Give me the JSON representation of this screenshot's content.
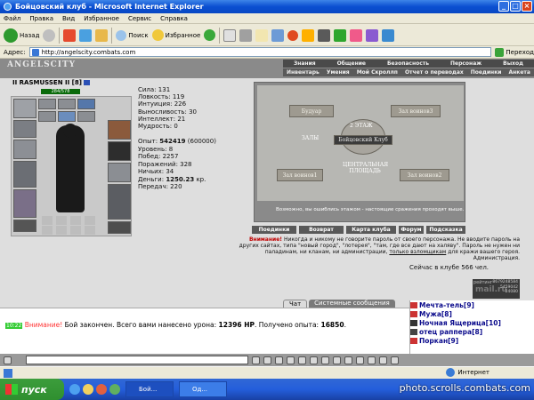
{
  "window": {
    "title": "Бойцовский клуб - Microsoft Internet Explorer"
  },
  "menubar": [
    "Файл",
    "Правка",
    "Вид",
    "Избранное",
    "Сервис",
    "Справка"
  ],
  "toolbar": {
    "back": "Назад",
    "search": "Поиск",
    "favorites": "Избранное"
  },
  "address": {
    "label": "Адрес:",
    "url": "http://angelscity.combats.com",
    "go": "Переход"
  },
  "site": {
    "logo": "ANGELSCITY",
    "nav_top": [
      "Знания",
      "Общение",
      "Безопасность",
      "Персонаж",
      "Выход"
    ],
    "nav_sub": [
      "Инвентарь",
      "Умения",
      "Мой Скроллп",
      "Отчет о переводах",
      "Поединки",
      "Анкета"
    ]
  },
  "character": {
    "name": "II RASMUSSEN II",
    "level_badge": "[8]",
    "hp": "284/578",
    "stats": [
      "Сила: 131",
      "Ловкость: 119",
      "Интуиция: 226",
      "Выносливость: 30",
      "Интеллект: 21",
      "Мудрость: 0"
    ],
    "exp_label": "Опыт:",
    "exp_value": "542419",
    "exp_next": "(600000)",
    "level": "Уровень: 8",
    "wins": "Побед: 2257",
    "losses": "Поражений: 328",
    "draws": "Ничьих: 34",
    "money_label": "Деньги:",
    "money_value": "1250.23",
    "money_unit": "кр.",
    "transfers": "Передач: 220"
  },
  "map": {
    "rooms": {
      "buduar": "Будуар",
      "floor2": "2 ЭТАЖ",
      "room_top_right": "Зал воинов3",
      "halls": "ЗАЛЫ",
      "center": "Бойцовский Клуб",
      "room_left": "Зал воинов1",
      "central_square": "ЦЕНТРАЛЬНАЯ ПЛОЩАДЬ",
      "room_right": "Зал воинов2"
    },
    "caption": "Возможно, вы ошиблись этажом - настоящие сражения проходят выше."
  },
  "buttons": [
    "Поединки",
    "Возврат",
    "Карта клуба",
    "Форум",
    "Подсказка"
  ],
  "notice": {
    "warn": "Внимание!",
    "text1": "Никогда и никому не говорите пароль от своего персонажа. Не вводите пароль на",
    "text2": "других сайтах, типа \"новый город\", \"лотерея\", \"там, где все дают на халяву\". Пароль не нужен ни",
    "text3a": "паладинам, ни кланам, ни администрации,",
    "text3b": "только взломщикам",
    "text3c": "для кражи вашего героя.",
    "signature": "Администрация."
  },
  "online": "Сейчас в клубе 566 чел.",
  "counter": {
    "rating": "рейтинг",
    "brand": "mail.ru",
    "n1": "8679248584",
    "n2": "5459042",
    "n3": "24080"
  },
  "chat": {
    "tabs": [
      "Чат",
      "Системные сообщения"
    ],
    "time": "10:22",
    "attention": "Внимание!",
    "msg1": "Бой закончен. Всего вами нанесено урона:",
    "damage": "12396 HP",
    "msg2": ". Получено опыта:",
    "exp": "16850",
    "end": "."
  },
  "users": [
    "Мечта-тель[9]",
    "Мужа[8]",
    "Ночная Ящерица[10]",
    "отец раппера[8]",
    "Поркан[9]"
  ],
  "statusbar": {
    "zone": "Интернет"
  },
  "taskbar": {
    "start": "пуск",
    "tasks": [
      "Бой...",
      "Од..."
    ]
  },
  "watermark": "photo.scrolls.combats.com",
  "colors": {
    "accent": "#c00000",
    "timestamp": "#33cc33",
    "user_names": "#0b0b8c"
  }
}
